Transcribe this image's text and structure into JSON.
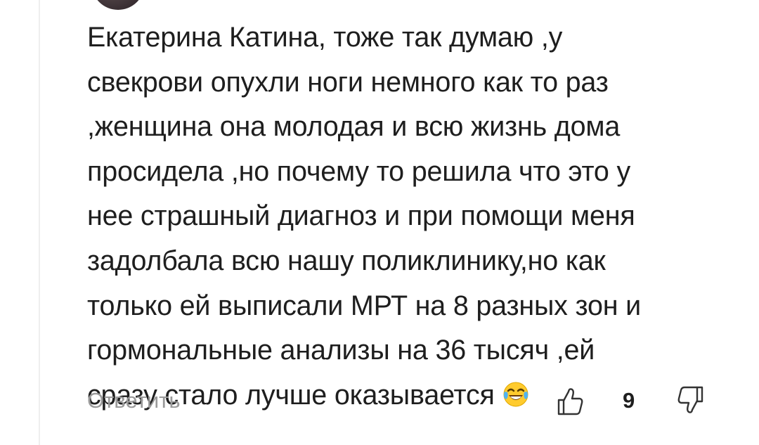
{
  "comment": {
    "text": "Екатерина Катина, тоже так думаю ,у\nсвекрови опухли ноги немного как то раз\n,женщина она молодая и всю жизнь дома\nпросидела ,но почему то решила что это у\nнее страшный диагноз и при помощи меня\nзадолбала всю нашу поликлинику,но как\nтолько ей выписали МРТ на 8 разных зон и\nгормональные анализы на 36 тысяч ,ей\nсразу стало лучше оказывается",
    "emoji_icon": "face-with-tears-of-joy-icon"
  },
  "actions": {
    "reply_label": "Ответить",
    "like_count": "9",
    "like_icon": "thumbs-up-icon",
    "dislike_icon": "thumbs-down-icon"
  }
}
